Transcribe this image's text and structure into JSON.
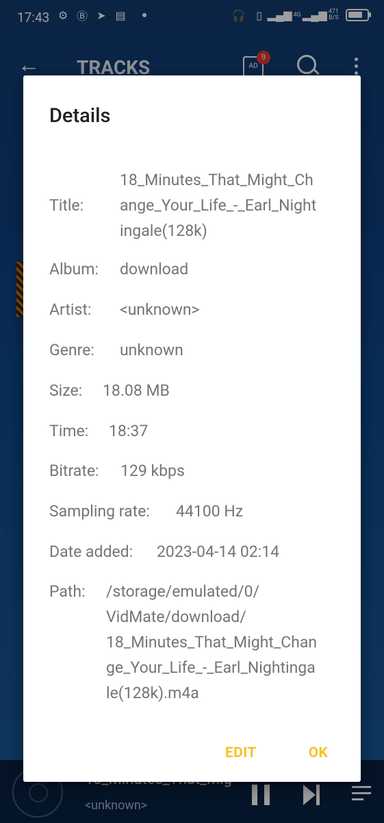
{
  "status_bar": {
    "time": "17:43",
    "left_icons": [
      "gear-icon",
      "b-bubble-icon",
      "telegram-icon",
      "news-icon"
    ],
    "net_type": "4G",
    "speed": "471\nB/S"
  },
  "app_bar": {
    "title": "TRACKS",
    "ad_badge_count": "9",
    "ad_label": "AD"
  },
  "dialog": {
    "title": "Details",
    "fields": [
      {
        "label": "Title:",
        "value": "18_Minutes_That_Might_Ch\nange_Your_Life_-_Earl_Night\ningale(128k)"
      },
      {
        "label": "Album:",
        "value": "download"
      },
      {
        "label": "Artist:",
        "value": "<unknown>"
      },
      {
        "label": "Genre:",
        "value": "unknown"
      },
      {
        "label": "Size:",
        "value": "18.08 MB"
      },
      {
        "label": "Time:",
        "value": "18:37"
      },
      {
        "label": "Bitrate:",
        "value": "129 kbps"
      },
      {
        "label": "Sampling rate:",
        "value": "44100 Hz"
      },
      {
        "label": "Date added:",
        "value": "2023-04-14 02:14"
      },
      {
        "label": "Path:",
        "value": "/storage/emulated/0/\nVidMate/download/\n18_Minutes_That_Might_Chan\nge_Your_Life_-_Earl_Nightinga\nle(128k).m4a"
      }
    ],
    "edit_label": "EDIT",
    "ok_label": "OK"
  },
  "mini_player": {
    "title": "18_Minutes_That_Mig",
    "artist": "<unknown>"
  },
  "colors": {
    "accent": "#f2c42a",
    "dialog_text": "#757575",
    "dialog_title": "#212121"
  }
}
